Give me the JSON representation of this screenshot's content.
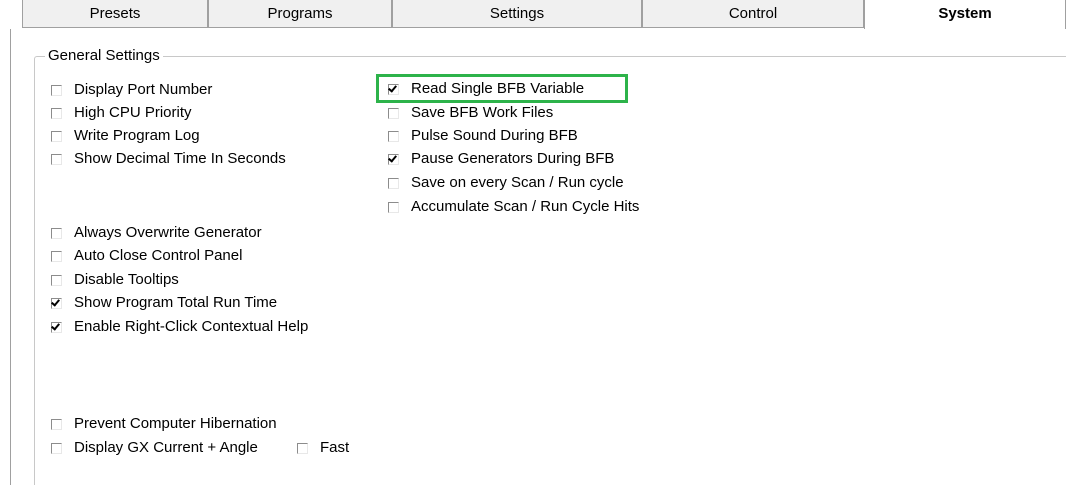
{
  "tabs": [
    {
      "label": "Presets",
      "active": false
    },
    {
      "label": "Programs",
      "active": false
    },
    {
      "label": "Settings",
      "active": false
    },
    {
      "label": "Control",
      "active": false
    },
    {
      "label": "System",
      "active": true
    }
  ],
  "group": {
    "title": "General Settings",
    "left_column": [
      {
        "label": "Display Port Number",
        "checked": false
      },
      {
        "label": "High CPU Priority",
        "checked": false
      },
      {
        "label": "Write Program Log",
        "checked": false
      },
      {
        "label": "Show Decimal Time In Seconds",
        "checked": false
      },
      {
        "label": "Always Overwrite Generator",
        "checked": false
      },
      {
        "label": "Auto Close Control Panel",
        "checked": false
      },
      {
        "label": "Disable Tooltips",
        "checked": false
      },
      {
        "label": "Show Program Total Run Time",
        "checked": true
      },
      {
        "label": "Enable Right-Click Contextual Help",
        "checked": true
      },
      {
        "label": "Prevent Computer Hibernation",
        "checked": false
      },
      {
        "label": "Display GX Current + Angle",
        "checked": false
      },
      {
        "label": "Fast",
        "checked": false
      }
    ],
    "right_column": [
      {
        "label": "Read Single BFB Variable",
        "checked": true
      },
      {
        "label": "Save BFB Work Files",
        "checked": false
      },
      {
        "label": "Pulse Sound During BFB",
        "checked": false
      },
      {
        "label": "Pause Generators During BFB",
        "checked": true
      },
      {
        "label": "Save on every Scan / Run cycle",
        "checked": false
      },
      {
        "label": "Accumulate Scan / Run Cycle Hits",
        "checked": false
      }
    ]
  },
  "highlight_color": "#2db34a"
}
